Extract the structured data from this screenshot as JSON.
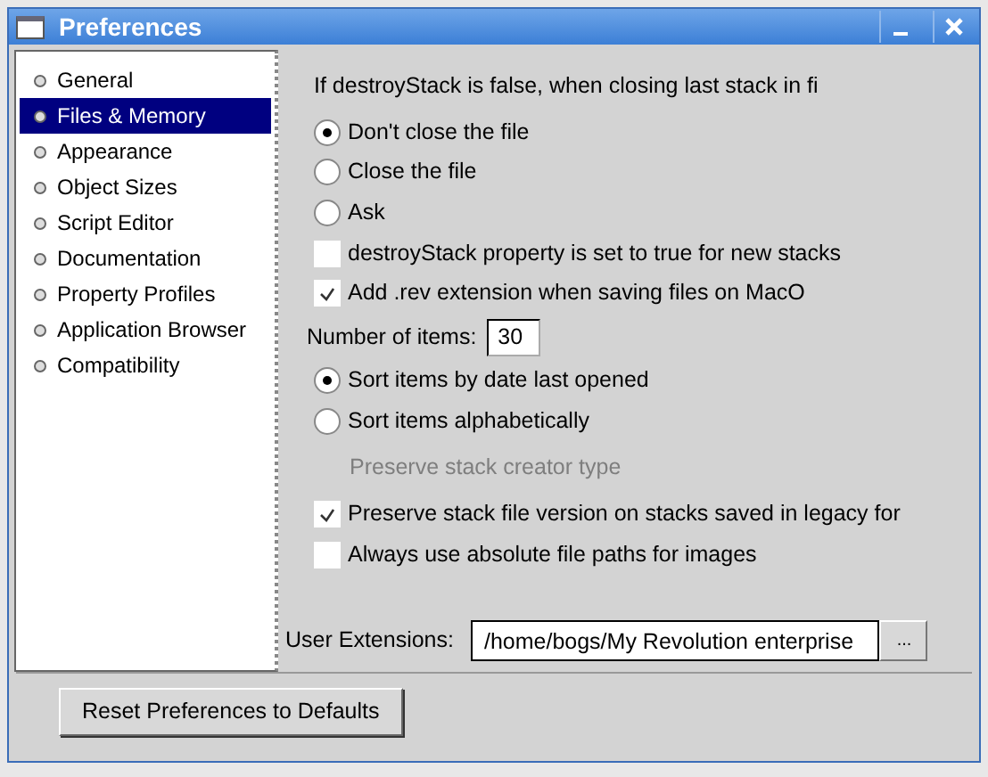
{
  "window": {
    "title": "Preferences"
  },
  "sidebar": {
    "items": [
      {
        "label": "General",
        "selected": false
      },
      {
        "label": "Files & Memory",
        "selected": true
      },
      {
        "label": "Appearance",
        "selected": false
      },
      {
        "label": "Object Sizes",
        "selected": false
      },
      {
        "label": "Script Editor",
        "selected": false
      },
      {
        "label": "Documentation",
        "selected": false
      },
      {
        "label": "Property Profiles",
        "selected": false
      },
      {
        "label": "Application Browser",
        "selected": false
      },
      {
        "label": "Compatibility",
        "selected": false
      }
    ]
  },
  "panel": {
    "heading": "If destroyStack is false, when closing last stack in fi",
    "options": [
      {
        "kind": "radio",
        "label": "Don't close the file",
        "selected": true
      },
      {
        "kind": "radio",
        "label": "Close the file",
        "selected": false
      },
      {
        "kind": "radio",
        "label": "Ask",
        "selected": false
      },
      {
        "kind": "checkbox",
        "label": "destroyStack property is set to true for new stacks",
        "checked": false
      },
      {
        "kind": "checkbox",
        "label": "Add .rev extension when saving files on MacO",
        "checked": true
      },
      {
        "kind": "number",
        "label": "Number of items:",
        "value": "30"
      },
      {
        "kind": "radio",
        "label": "Sort items by date last opened",
        "selected": true
      },
      {
        "kind": "radio",
        "label": "Sort items alphabetically",
        "selected": false
      },
      {
        "kind": "note",
        "label": "Preserve stack creator type",
        "disabled": true
      },
      {
        "kind": "checkbox",
        "label": "Preserve stack file version on stacks saved in legacy for",
        "checked": true
      },
      {
        "kind": "checkbox",
        "label": "Always use absolute file paths for images",
        "checked": false
      }
    ],
    "user_extensions": {
      "label": "User Extensions:",
      "value": "/home/bogs/My Revolution enterprise",
      "browse": "..."
    }
  },
  "buttons": [
    "Reset Preferences to Defaults"
  ]
}
